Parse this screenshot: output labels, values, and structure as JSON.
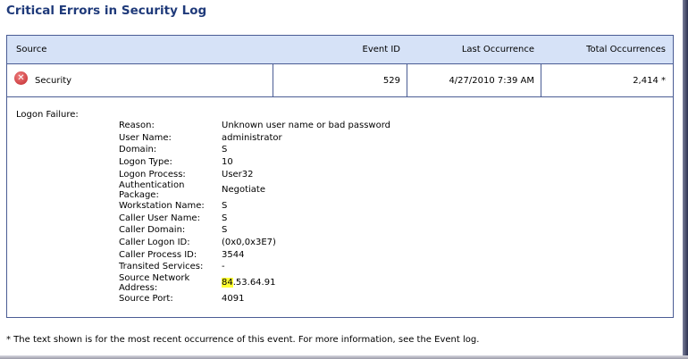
{
  "title": "Critical Errors in Security Log",
  "columns": [
    "Source",
    "Event ID",
    "Last Occurrence",
    "Total Occurrences"
  ],
  "row": {
    "icon": "error-icon",
    "source": "Security",
    "event_id": "529",
    "last_occurrence": "4/27/2010 7:39 AM",
    "total": "2,414 *"
  },
  "section_title": "Logon Failure:",
  "details": [
    {
      "label": "Reason:",
      "value": "Unknown user name or bad password"
    },
    {
      "label": "User Name:",
      "value": "administrator"
    },
    {
      "label": "Domain:",
      "value": "S"
    },
    {
      "label": "Logon Type:",
      "value": "10"
    },
    {
      "label": "Logon Process:",
      "value": "User32"
    },
    {
      "label": "Authentication Package:",
      "value": "Negotiate"
    },
    {
      "label": "Workstation Name:",
      "value": "S"
    },
    {
      "label": "Caller User Name:",
      "value": "S"
    },
    {
      "label": "Caller Domain:",
      "value": "S"
    },
    {
      "label": "Caller Logon ID:",
      "value": "(0x0,0x3E7)"
    },
    {
      "label": "Caller Process ID:",
      "value": "3544"
    },
    {
      "label": "Transited Services:",
      "value": "-"
    },
    {
      "label": "Source Network Address:",
      "value_highlight": "84",
      "value": ".53.64.91"
    },
    {
      "label": "Source Port:",
      "value": "4091"
    }
  ],
  "highlight_color": "#ffff33",
  "footnote": "* The text shown is for the most recent occurrence of this event. For more information, see the Event log."
}
